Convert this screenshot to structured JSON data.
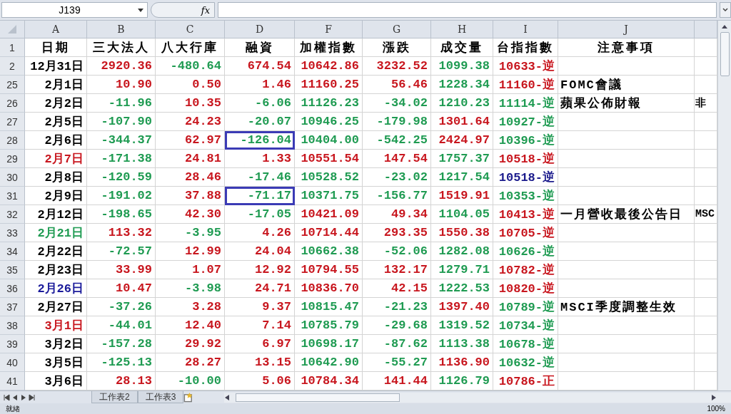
{
  "formula_bar": {
    "name_box": "J139",
    "function_label": "fx"
  },
  "columns": [
    "A",
    "B",
    "C",
    "D",
    "F",
    "G",
    "H",
    "I",
    "J"
  ],
  "rows": [
    {
      "num": "1",
      "cells": [
        {
          "text": "日期",
          "color": "#000000",
          "outlined": false
        },
        {
          "text": "三大法人",
          "color": "#000000",
          "outlined": false
        },
        {
          "text": "八大行庫",
          "color": "#000000",
          "outlined": false
        },
        {
          "text": "融資",
          "color": "#000000",
          "outlined": false
        },
        {
          "text": "加權指數",
          "color": "#000000",
          "outlined": false
        },
        {
          "text": "漲跌",
          "color": "#000000",
          "outlined": false
        },
        {
          "text": "成交量",
          "color": "#000000",
          "outlined": false
        },
        {
          "text": "台指指數",
          "color": "#000000",
          "outlined": false
        },
        {
          "text": "注意事項",
          "color": "#000000",
          "outlined": false
        }
      ]
    },
    {
      "num": "2",
      "cells": [
        {
          "text": "12月31日",
          "color": "#000000",
          "outlined": false
        },
        {
          "text": "2920.36",
          "color": "#c8161e",
          "outlined": false
        },
        {
          "text": "-480.64",
          "color": "#1f9b52",
          "outlined": false
        },
        {
          "text": "674.54",
          "color": "#c8161e",
          "outlined": false
        },
        {
          "text": "10642.86",
          "color": "#c8161e",
          "outlined": false
        },
        {
          "text": "3232.52",
          "color": "#c8161e",
          "outlined": false
        },
        {
          "text": "1099.38",
          "color": "#1f9b52",
          "outlined": false
        },
        {
          "text": "10633-逆",
          "color": "#c8161e",
          "outlined": false
        }
      ]
    },
    {
      "num": "25",
      "cells": [
        {
          "text": "2月1日",
          "color": "#000000",
          "outlined": false
        },
        {
          "text": "10.90",
          "color": "#c8161e",
          "outlined": false
        },
        {
          "text": "0.50",
          "color": "#c8161e",
          "outlined": false
        },
        {
          "text": "1.46",
          "color": "#c8161e",
          "outlined": false
        },
        {
          "text": "11160.25",
          "color": "#c8161e",
          "outlined": false
        },
        {
          "text": "56.46",
          "color": "#c8161e",
          "outlined": false
        },
        {
          "text": "1228.34",
          "color": "#1f9b52",
          "outlined": false
        },
        {
          "text": "11160-逆",
          "color": "#c8161e",
          "outlined": false
        },
        {
          "text": "FOMC會議",
          "color": "#000000",
          "outlined": false
        }
      ]
    },
    {
      "num": "26",
      "cells": [
        {
          "text": "2月2日",
          "color": "#000000",
          "outlined": false
        },
        {
          "text": "-11.96",
          "color": "#1f9b52",
          "outlined": false
        },
        {
          "text": "10.35",
          "color": "#c8161e",
          "outlined": false
        },
        {
          "text": "-6.06",
          "color": "#1f9b52",
          "outlined": false
        },
        {
          "text": "11126.23",
          "color": "#1f9b52",
          "outlined": false
        },
        {
          "text": "-34.02",
          "color": "#1f9b52",
          "outlined": false
        },
        {
          "text": "1210.23",
          "color": "#1f9b52",
          "outlined": false
        },
        {
          "text": "11114-逆",
          "color": "#1f9b52",
          "outlined": false
        },
        {
          "text": "蘋果公佈財報",
          "color": "#000000",
          "outlined": false
        }
      ],
      "overflow": "非"
    },
    {
      "num": "27",
      "cells": [
        {
          "text": "2月5日",
          "color": "#000000",
          "outlined": false
        },
        {
          "text": "-107.90",
          "color": "#1f9b52",
          "outlined": false
        },
        {
          "text": "24.23",
          "color": "#c8161e",
          "outlined": false
        },
        {
          "text": "-20.07",
          "color": "#1f9b52",
          "outlined": false
        },
        {
          "text": "10946.25",
          "color": "#1f9b52",
          "outlined": false
        },
        {
          "text": "-179.98",
          "color": "#1f9b52",
          "outlined": false
        },
        {
          "text": "1301.64",
          "color": "#c8161e",
          "outlined": false
        },
        {
          "text": "10927-逆",
          "color": "#1f9b52",
          "outlined": false
        }
      ]
    },
    {
      "num": "28",
      "cells": [
        {
          "text": "2月6日",
          "color": "#000000",
          "outlined": false
        },
        {
          "text": "-344.37",
          "color": "#1f9b52",
          "outlined": false
        },
        {
          "text": "62.97",
          "color": "#c8161e",
          "outlined": false
        },
        {
          "text": "-126.04",
          "color": "#1f9b52",
          "outlined": true
        },
        {
          "text": "10404.00",
          "color": "#1f9b52",
          "outlined": false
        },
        {
          "text": "-542.25",
          "color": "#1f9b52",
          "outlined": false
        },
        {
          "text": "2424.97",
          "color": "#c8161e",
          "outlined": false
        },
        {
          "text": "10396-逆",
          "color": "#1f9b52",
          "outlined": false
        }
      ]
    },
    {
      "num": "29",
      "cells": [
        {
          "text": "2月7日",
          "color": "#c8161e",
          "outlined": false
        },
        {
          "text": "-171.38",
          "color": "#1f9b52",
          "outlined": false
        },
        {
          "text": "24.81",
          "color": "#c8161e",
          "outlined": false
        },
        {
          "text": "1.33",
          "color": "#c8161e",
          "outlined": false
        },
        {
          "text": "10551.54",
          "color": "#c8161e",
          "outlined": false
        },
        {
          "text": "147.54",
          "color": "#c8161e",
          "outlined": false
        },
        {
          "text": "1757.37",
          "color": "#1f9b52",
          "outlined": false
        },
        {
          "text": "10518-逆",
          "color": "#c8161e",
          "outlined": false
        }
      ]
    },
    {
      "num": "30",
      "cells": [
        {
          "text": "2月8日",
          "color": "#000000",
          "outlined": false
        },
        {
          "text": "-120.59",
          "color": "#1f9b52",
          "outlined": false
        },
        {
          "text": "28.46",
          "color": "#c8161e",
          "outlined": false
        },
        {
          "text": "-17.46",
          "color": "#1f9b52",
          "outlined": false
        },
        {
          "text": "10528.52",
          "color": "#1f9b52",
          "outlined": false
        },
        {
          "text": "-23.02",
          "color": "#1f9b52",
          "outlined": false
        },
        {
          "text": "1217.54",
          "color": "#1f9b52",
          "outlined": false
        },
        {
          "text": "10518-逆",
          "color": "#1a1a8c",
          "outlined": false
        }
      ]
    },
    {
      "num": "31",
      "cells": [
        {
          "text": "2月9日",
          "color": "#000000",
          "outlined": false
        },
        {
          "text": "-191.02",
          "color": "#1f9b52",
          "outlined": false
        },
        {
          "text": "37.88",
          "color": "#c8161e",
          "outlined": false
        },
        {
          "text": "-71.17",
          "color": "#1f9b52",
          "outlined": true
        },
        {
          "text": "10371.75",
          "color": "#1f9b52",
          "outlined": false
        },
        {
          "text": "-156.77",
          "color": "#1f9b52",
          "outlined": false
        },
        {
          "text": "1519.91",
          "color": "#c8161e",
          "outlined": false
        },
        {
          "text": "10353-逆",
          "color": "#1f9b52",
          "outlined": false
        }
      ]
    },
    {
      "num": "32",
      "cells": [
        {
          "text": "2月12日",
          "color": "#000000",
          "outlined": false
        },
        {
          "text": "-198.65",
          "color": "#1f9b52",
          "outlined": false
        },
        {
          "text": "42.30",
          "color": "#c8161e",
          "outlined": false
        },
        {
          "text": "-17.05",
          "color": "#1f9b52",
          "outlined": false
        },
        {
          "text": "10421.09",
          "color": "#c8161e",
          "outlined": false
        },
        {
          "text": "49.34",
          "color": "#c8161e",
          "outlined": false
        },
        {
          "text": "1104.05",
          "color": "#1f9b52",
          "outlined": false
        },
        {
          "text": "10413-逆",
          "color": "#c8161e",
          "outlined": false
        },
        {
          "text": "一月營收最後公告日",
          "color": "#000000",
          "outlined": false
        }
      ],
      "overflow": "MSC"
    },
    {
      "num": "33",
      "cells": [
        {
          "text": "2月21日",
          "color": "#1f9b52",
          "outlined": false
        },
        {
          "text": "113.32",
          "color": "#c8161e",
          "outlined": false
        },
        {
          "text": "-3.95",
          "color": "#1f9b52",
          "outlined": false
        },
        {
          "text": "4.26",
          "color": "#c8161e",
          "outlined": false
        },
        {
          "text": "10714.44",
          "color": "#c8161e",
          "outlined": false
        },
        {
          "text": "293.35",
          "color": "#c8161e",
          "outlined": false
        },
        {
          "text": "1550.38",
          "color": "#c8161e",
          "outlined": false
        },
        {
          "text": "10705-逆",
          "color": "#c8161e",
          "outlined": false
        }
      ]
    },
    {
      "num": "34",
      "cells": [
        {
          "text": "2月22日",
          "color": "#000000",
          "outlined": false
        },
        {
          "text": "-72.57",
          "color": "#1f9b52",
          "outlined": false
        },
        {
          "text": "12.99",
          "color": "#c8161e",
          "outlined": false
        },
        {
          "text": "24.04",
          "color": "#c8161e",
          "outlined": false
        },
        {
          "text": "10662.38",
          "color": "#1f9b52",
          "outlined": false
        },
        {
          "text": "-52.06",
          "color": "#1f9b52",
          "outlined": false
        },
        {
          "text": "1282.08",
          "color": "#1f9b52",
          "outlined": false
        },
        {
          "text": "10626-逆",
          "color": "#1f9b52",
          "outlined": false
        }
      ]
    },
    {
      "num": "35",
      "cells": [
        {
          "text": "2月23日",
          "color": "#000000",
          "outlined": false
        },
        {
          "text": "33.99",
          "color": "#c8161e",
          "outlined": false
        },
        {
          "text": "1.07",
          "color": "#c8161e",
          "outlined": false
        },
        {
          "text": "12.92",
          "color": "#c8161e",
          "outlined": false
        },
        {
          "text": "10794.55",
          "color": "#c8161e",
          "outlined": false
        },
        {
          "text": "132.17",
          "color": "#c8161e",
          "outlined": false
        },
        {
          "text": "1279.71",
          "color": "#1f9b52",
          "outlined": false
        },
        {
          "text": "10782-逆",
          "color": "#c8161e",
          "outlined": false
        }
      ]
    },
    {
      "num": "36",
      "cells": [
        {
          "text": "2月26日",
          "color": "#1a1a9a",
          "outlined": false
        },
        {
          "text": "10.47",
          "color": "#c8161e",
          "outlined": false
        },
        {
          "text": "-3.98",
          "color": "#1f9b52",
          "outlined": false
        },
        {
          "text": "24.71",
          "color": "#c8161e",
          "outlined": false
        },
        {
          "text": "10836.70",
          "color": "#c8161e",
          "outlined": false
        },
        {
          "text": "42.15",
          "color": "#c8161e",
          "outlined": false
        },
        {
          "text": "1222.53",
          "color": "#1f9b52",
          "outlined": false
        },
        {
          "text": "10820-逆",
          "color": "#c8161e",
          "outlined": false
        }
      ]
    },
    {
      "num": "37",
      "cells": [
        {
          "text": "2月27日",
          "color": "#000000",
          "outlined": false
        },
        {
          "text": "-37.26",
          "color": "#1f9b52",
          "outlined": false
        },
        {
          "text": "3.28",
          "color": "#c8161e",
          "outlined": false
        },
        {
          "text": "9.37",
          "color": "#c8161e",
          "outlined": false
        },
        {
          "text": "10815.47",
          "color": "#1f9b52",
          "outlined": false
        },
        {
          "text": "-21.23",
          "color": "#1f9b52",
          "outlined": false
        },
        {
          "text": "1397.40",
          "color": "#c8161e",
          "outlined": false
        },
        {
          "text": "10789-逆",
          "color": "#1f9b52",
          "outlined": false
        },
        {
          "text": "MSCI季度調整生效",
          "color": "#000000",
          "outlined": false
        }
      ]
    },
    {
      "num": "38",
      "cells": [
        {
          "text": "3月1日",
          "color": "#c8161e",
          "outlined": false
        },
        {
          "text": "-44.01",
          "color": "#1f9b52",
          "outlined": false
        },
        {
          "text": "12.40",
          "color": "#c8161e",
          "outlined": false
        },
        {
          "text": "7.14",
          "color": "#c8161e",
          "outlined": false
        },
        {
          "text": "10785.79",
          "color": "#1f9b52",
          "outlined": false
        },
        {
          "text": "-29.68",
          "color": "#1f9b52",
          "outlined": false
        },
        {
          "text": "1319.52",
          "color": "#1f9b52",
          "outlined": false
        },
        {
          "text": "10734-逆",
          "color": "#1f9b52",
          "outlined": false
        }
      ]
    },
    {
      "num": "39",
      "cells": [
        {
          "text": "3月2日",
          "color": "#000000",
          "outlined": false
        },
        {
          "text": "-157.28",
          "color": "#1f9b52",
          "outlined": false
        },
        {
          "text": "29.92",
          "color": "#c8161e",
          "outlined": false
        },
        {
          "text": "6.97",
          "color": "#c8161e",
          "outlined": false
        },
        {
          "text": "10698.17",
          "color": "#1f9b52",
          "outlined": false
        },
        {
          "text": "-87.62",
          "color": "#1f9b52",
          "outlined": false
        },
        {
          "text": "1113.38",
          "color": "#1f9b52",
          "outlined": false
        },
        {
          "text": "10678-逆",
          "color": "#1f9b52",
          "outlined": false
        }
      ]
    },
    {
      "num": "40",
      "cells": [
        {
          "text": "3月5日",
          "color": "#000000",
          "outlined": false
        },
        {
          "text": "-125.13",
          "color": "#1f9b52",
          "outlined": false
        },
        {
          "text": "28.27",
          "color": "#c8161e",
          "outlined": false
        },
        {
          "text": "13.15",
          "color": "#c8161e",
          "outlined": false
        },
        {
          "text": "10642.90",
          "color": "#1f9b52",
          "outlined": false
        },
        {
          "text": "-55.27",
          "color": "#1f9b52",
          "outlined": false
        },
        {
          "text": "1136.90",
          "color": "#c8161e",
          "outlined": false
        },
        {
          "text": "10632-逆",
          "color": "#1f9b52",
          "outlined": false
        }
      ]
    },
    {
      "num": "41",
      "cells": [
        {
          "text": "3月6日",
          "color": "#000000",
          "outlined": false
        },
        {
          "text": "28.13",
          "color": "#c8161e",
          "outlined": false
        },
        {
          "text": "-10.00",
          "color": "#1f9b52",
          "outlined": false
        },
        {
          "text": "5.06",
          "color": "#c8161e",
          "outlined": false
        },
        {
          "text": "10784.34",
          "color": "#c8161e",
          "outlined": false
        },
        {
          "text": "141.44",
          "color": "#c8161e",
          "outlined": false
        },
        {
          "text": "1126.79",
          "color": "#1f9b52",
          "outlined": false
        },
        {
          "text": "10786-正",
          "color": "#c8161e",
          "outlined": false
        }
      ]
    }
  ],
  "sheet_tabs": [
    {
      "label": "工作表2",
      "selected": false
    },
    {
      "label": "工作表3",
      "selected": false
    }
  ],
  "status_bar": {
    "status": "就緒",
    "zoom": "100%"
  }
}
